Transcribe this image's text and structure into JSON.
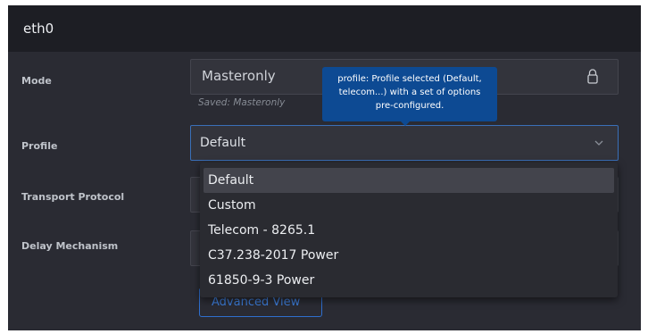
{
  "panel": {
    "title": "eth0"
  },
  "mode": {
    "label": "Mode",
    "value": "Masteronly",
    "saved_text": "Saved: Masteronly",
    "icon": "lock-icon"
  },
  "profile": {
    "label": "Profile",
    "value": "Default",
    "icon": "chevron-down-icon"
  },
  "transport": {
    "label": "Transport Protocol"
  },
  "delay": {
    "label": "Delay Mechanism"
  },
  "advanced": {
    "label": "Advanced View"
  },
  "tooltip": {
    "text": "profile: Profile selected (Default, telecom...) with a set of options pre-configured."
  },
  "dropdown": {
    "options": [
      "Default",
      "Custom",
      "Telecom - 8265.1",
      "C37.238-2017 Power",
      "61850-9-3 Power"
    ],
    "selected": "Default"
  },
  "colors": {
    "accent": "#2f6fce",
    "tooltip_bg": "#0d4a93",
    "panel_bg": "#2a2b33",
    "header_bg": "#1d1e24"
  }
}
